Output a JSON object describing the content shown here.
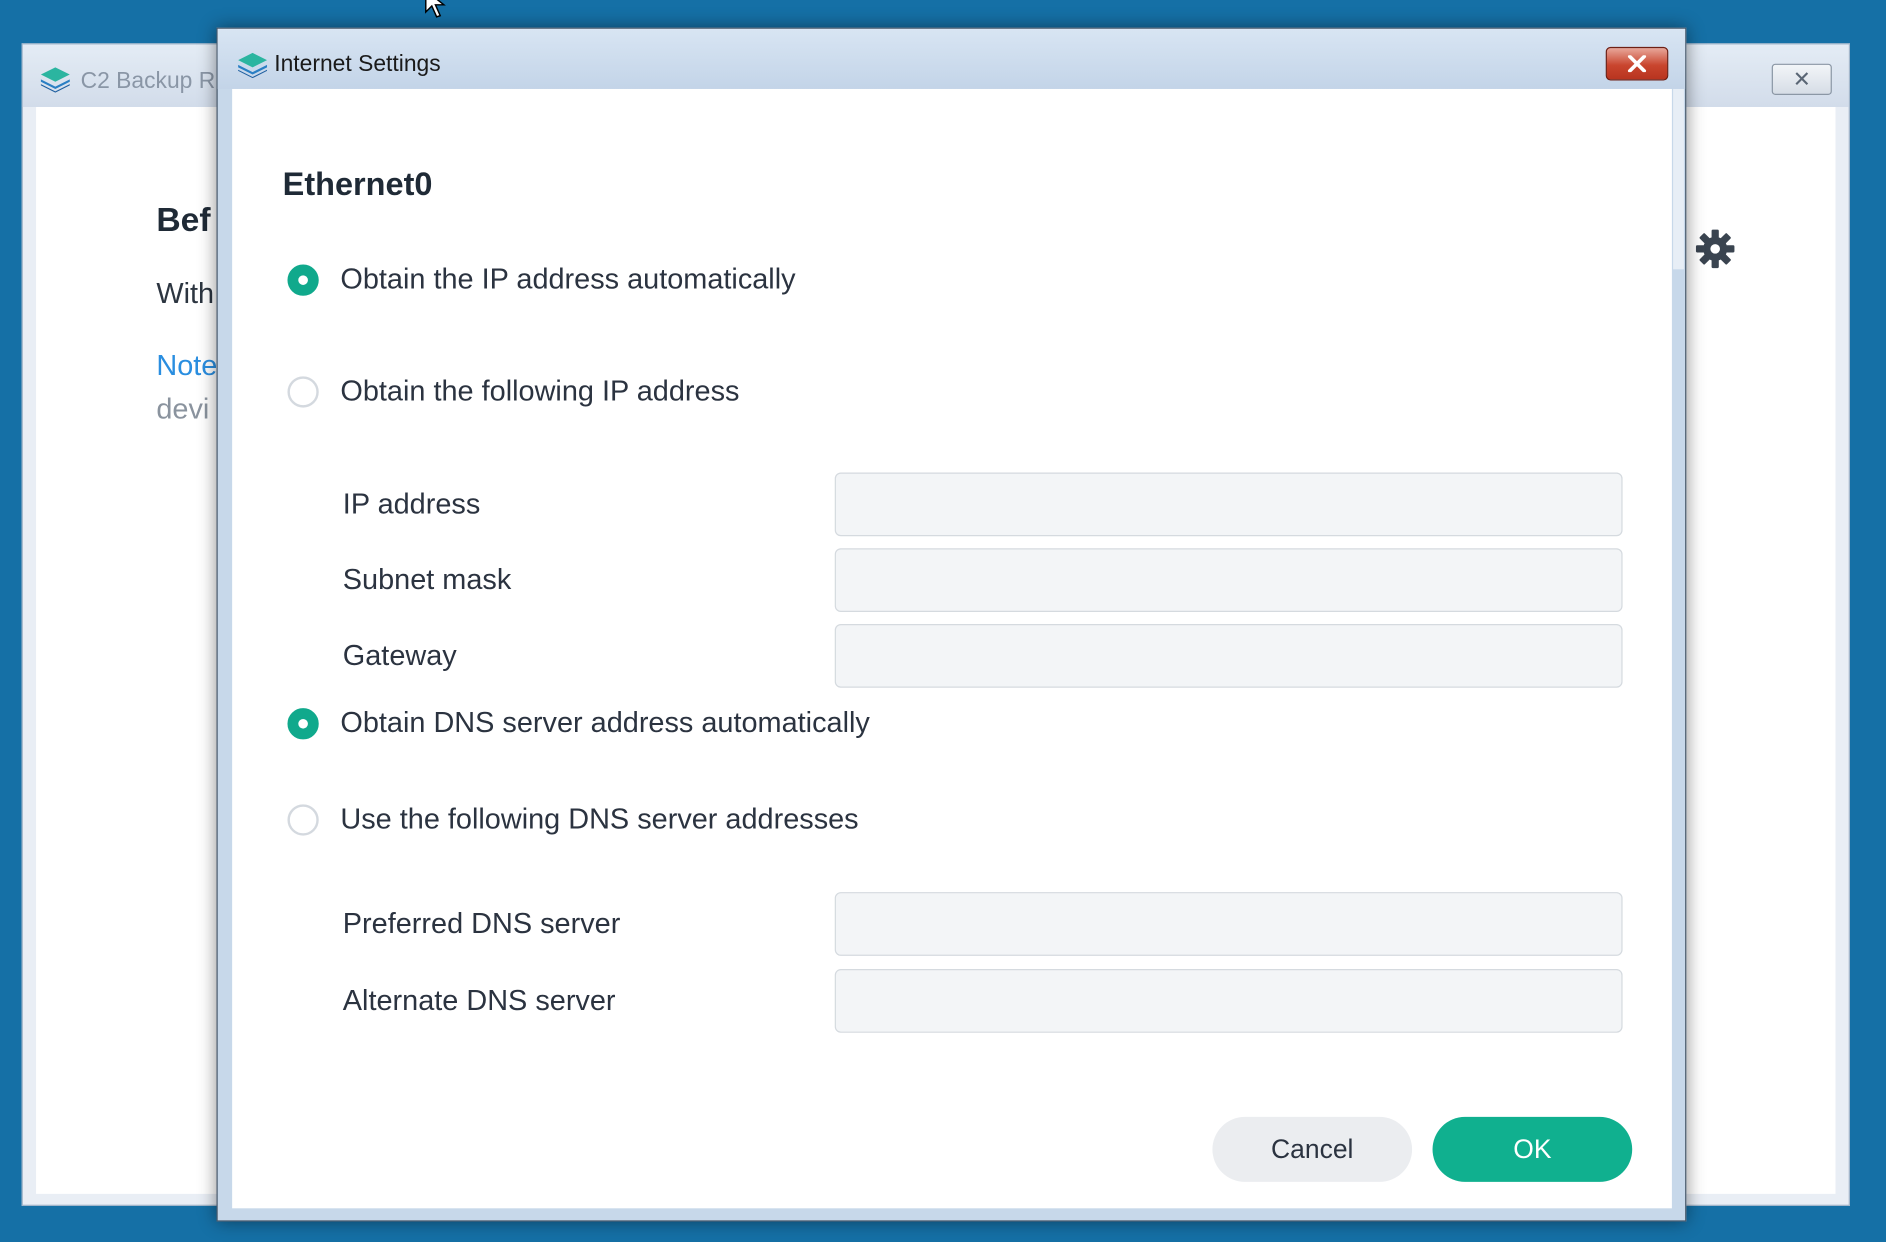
{
  "background_window": {
    "title": "C2 Backup R",
    "heading": "Bef",
    "line1": "With",
    "note": "Note",
    "line2": "devi"
  },
  "dialog": {
    "title": "Internet Settings",
    "section_title": "Ethernet0",
    "ip_options": {
      "auto_label": "Obtain the IP address automatically",
      "manual_label": "Obtain the following IP address",
      "selected": "auto"
    },
    "ip_fields": {
      "ip_address_label": "IP address",
      "ip_address_value": "",
      "subnet_mask_label": "Subnet mask",
      "subnet_mask_value": "",
      "gateway_label": "Gateway",
      "gateway_value": ""
    },
    "dns_options": {
      "auto_label": "Obtain DNS server address automatically",
      "manual_label": "Use the following DNS server addresses",
      "selected": "auto"
    },
    "dns_fields": {
      "preferred_label": "Preferred DNS server",
      "preferred_value": "",
      "alternate_label": "Alternate DNS server",
      "alternate_value": ""
    },
    "buttons": {
      "cancel": "Cancel",
      "ok": "OK"
    }
  },
  "colors": {
    "accent": "#10b08f",
    "desktop": "#1570a6",
    "close_button": "#c9452e",
    "link": "#2a8ee0"
  },
  "icons": {
    "app": "layers-icon",
    "close": "close-icon",
    "settings": "gear-icon",
    "cursor": "mouse-cursor-icon"
  }
}
